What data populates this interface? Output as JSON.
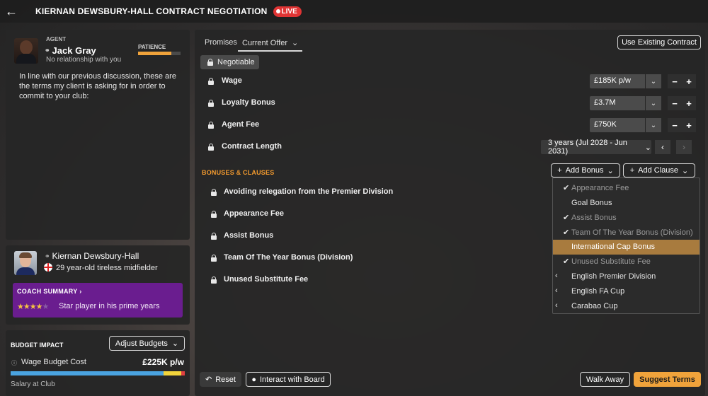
{
  "header": {
    "title": "KIERNAN DEWSBURY-HALL CONTRACT NEGOTIATION",
    "live_label": "LIVE",
    "back_icon": "arrow-left-icon"
  },
  "agent": {
    "section_label": "AGENT",
    "name": "Jack Gray",
    "relationship": "No relationship with you",
    "patience_label": "PATIENCE",
    "patience_level": 0.78,
    "message": "In line with our previous discussion, these are the terms my client is asking for in order to commit to your club:"
  },
  "player": {
    "name": "Kiernan Dewsbury-Hall",
    "description": "29 year-old tireless midfielder",
    "nationality_flag": "england-flag-icon",
    "coach_summary": {
      "title": "COACH SUMMARY",
      "stars": 4,
      "max_stars": 5,
      "text": "Star player in his prime years"
    }
  },
  "budget": {
    "title": "BUDGET IMPACT",
    "adjust_label": "Adjust Budgets",
    "wage_label": "Wage Budget Cost",
    "wage_value": "£225K p/w",
    "salary_label": "Salary at Club",
    "bar": {
      "blue": 0.88,
      "yellow": 0.1,
      "red": 0.02
    }
  },
  "tabs": {
    "promises": "Promises",
    "current_offer": "Current Offer"
  },
  "use_existing_label": "Use Existing Contract",
  "negotiable_label": "Negotiable",
  "terms": [
    {
      "label": "Wage",
      "value": "£185K p/w"
    },
    {
      "label": "Loyalty Bonus",
      "value": "£3.7M"
    },
    {
      "label": "Agent Fee",
      "value": "£750K"
    }
  ],
  "contract_length": {
    "label": "Contract Length",
    "value": "3 years (Jul 2028 - Jun 2031)"
  },
  "bonuses": {
    "section_title": "BONUSES & CLAUSES",
    "add_bonus_label": "Add Bonus",
    "add_clause_label": "Add Clause",
    "items": [
      "Avoiding relegation from the Premier Division",
      "Appearance Fee",
      "Assist Bonus",
      "Team Of The Year Bonus (Division)",
      "Unused Substitute Fee"
    ]
  },
  "dropdown": {
    "items": [
      {
        "label": "Appearance Fee",
        "state": "checked"
      },
      {
        "label": "Goal Bonus",
        "state": "normal"
      },
      {
        "label": "Assist Bonus",
        "state": "checked"
      },
      {
        "label": "Team Of The Year Bonus (Division)",
        "state": "checked"
      },
      {
        "label": "International Cap Bonus",
        "state": "highlighted"
      },
      {
        "label": "Unused Substitute Fee",
        "state": "checked"
      },
      {
        "label": "English Premier Division",
        "state": "submenu"
      },
      {
        "label": "English FA Cup",
        "state": "submenu"
      },
      {
        "label": "Carabao Cup",
        "state": "submenu"
      }
    ]
  },
  "footer": {
    "reset": "Reset",
    "interact": "Interact with Board",
    "walk_away": "Walk Away",
    "suggest": "Suggest Terms"
  },
  "colors": {
    "accent": "#f0a33b",
    "live": "#e03434",
    "coach_purple": "#6a1d8f",
    "section_orange": "#f29a2e"
  }
}
